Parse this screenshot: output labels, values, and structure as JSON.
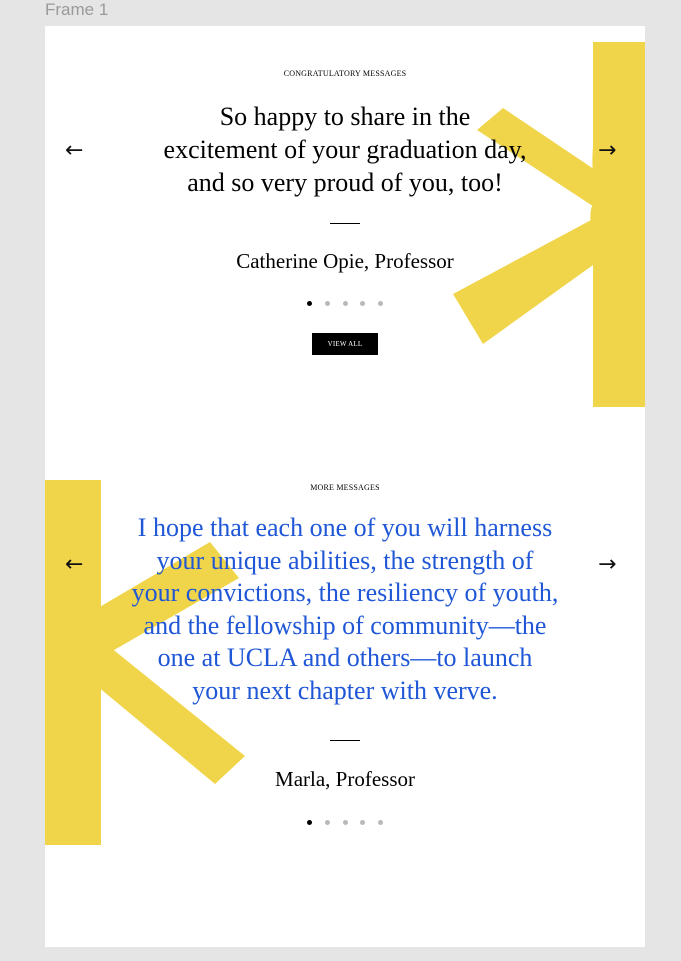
{
  "frame": {
    "label": "Frame 1"
  },
  "colors": {
    "accent_yellow": "#f0d54a",
    "quote_blue": "#1f57d6",
    "dot_active": "#000000",
    "dot_inactive": "#b9b9b9"
  },
  "congrats": {
    "eyebrow": "CONGRATULATORY MESSAGES",
    "quote_lines": [
      "So happy to share in the",
      "excitement of your graduation day,",
      "and so very proud of you, too!"
    ],
    "author": "Catherine Opie, Professor",
    "prev_icon": "arrow-left-icon",
    "next_icon": "arrow-right-icon",
    "prev_glyph": "←",
    "next_glyph": "→",
    "view_all_label": "VIEW ALL",
    "active_slide": 1,
    "slide_count": 5
  },
  "more": {
    "eyebrow": "MORE MESSAGES",
    "quote_lines": [
      "I hope that each one of you will harness",
      "your unique abilities, the strength of",
      "your convictions, the resiliency of youth,",
      "and the fellowship of community—the",
      "one at UCLA and others—to launch",
      "your next chapter with verve."
    ],
    "author": "Marla, Professor",
    "prev_icon": "arrow-left-icon",
    "next_icon": "arrow-right-icon",
    "prev_glyph": "←",
    "next_glyph": "→",
    "active_slide": 1,
    "slide_count": 5
  }
}
